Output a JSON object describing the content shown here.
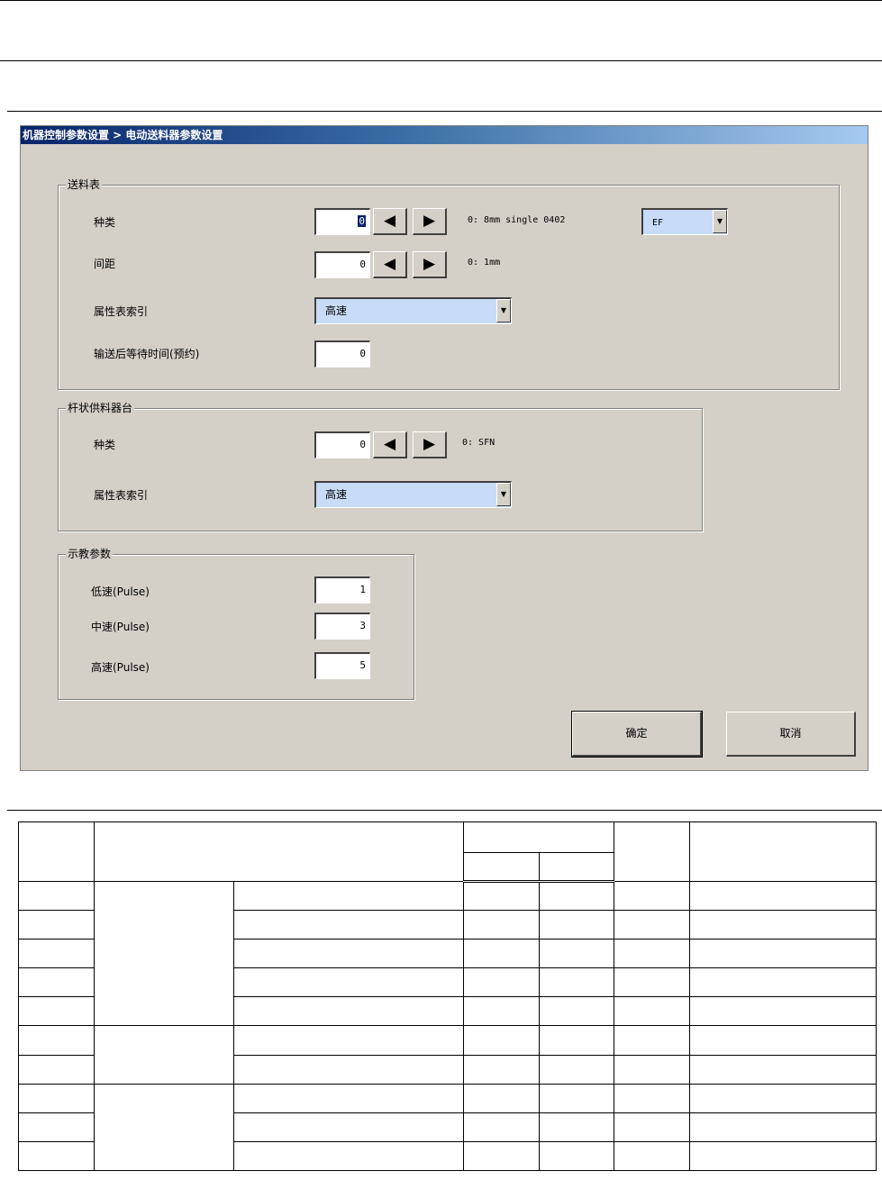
{
  "dialog": {
    "title": "机器控制参数设置 > 电动送料器参数设置",
    "feeder_table": {
      "title": "送料表",
      "type_label": "种类",
      "type_value": "0",
      "type_info": "0: 8mm single 0402",
      "type_combo": "EF",
      "pitch_label": "间距",
      "pitch_value": "0",
      "pitch_info": "0: 1mm",
      "attr_label": "属性表索引",
      "attr_value": "高速",
      "wait_label": "输送后等待时间(预约)",
      "wait_value": "0"
    },
    "stick_feeder": {
      "title": "杆状供料器台",
      "type_label": "种类",
      "type_value": "0",
      "type_info": "0: SFN",
      "attr_label": "属性表索引",
      "attr_value": "高速"
    },
    "teach_params": {
      "title": "示教参数",
      "low_label": "低速(Pulse)",
      "low_value": "1",
      "mid_label": "中速(Pulse)",
      "mid_value": "3",
      "high_label": "高速(Pulse)",
      "high_value": "5"
    },
    "ok_label": "确定",
    "cancel_label": "取消",
    "icons": {
      "left": "arrow-left-icon",
      "right": "arrow-right-icon",
      "dropdown": "dropdown-arrow-icon"
    }
  },
  "colors": {
    "dialog_bg": "#d4d0c8",
    "title_start": "#0a246a",
    "title_end": "#a6caf0",
    "combo_bg": "#c8dcf8"
  }
}
